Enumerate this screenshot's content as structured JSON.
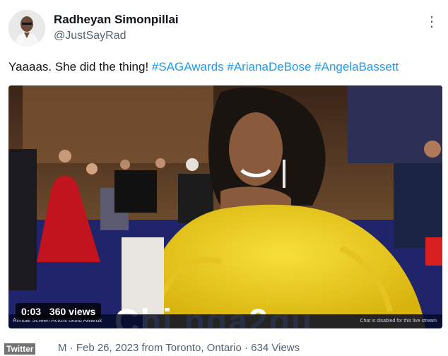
{
  "tweet": {
    "author": {
      "display_name": "Radheyan Simonpillai",
      "handle": "@JustSayRad"
    },
    "more_icon": "more-dots-icon",
    "text": "Yaaaas. She did the thing! ",
    "hashtags": [
      "#SAGAwards",
      "#ArianaDeBose",
      "#AngelaBassett"
    ],
    "media": {
      "time": "0:03",
      "views": "360 views",
      "caption_partial": "Chi nga2gu",
      "broadcast_lower_left": "Annual Screen Actors Guild Awards",
      "broadcast_lower_right": "Chat is disabled for this live stream"
    },
    "footer": {
      "logo": "Twitter",
      "meta": "M · Feb 26, 2023 from Toronto, Ontario · 634 Views"
    }
  },
  "colors": {
    "link": "#1d9bf0",
    "secondary_text": "#536471",
    "dress_yellow": "#f2d51e"
  }
}
